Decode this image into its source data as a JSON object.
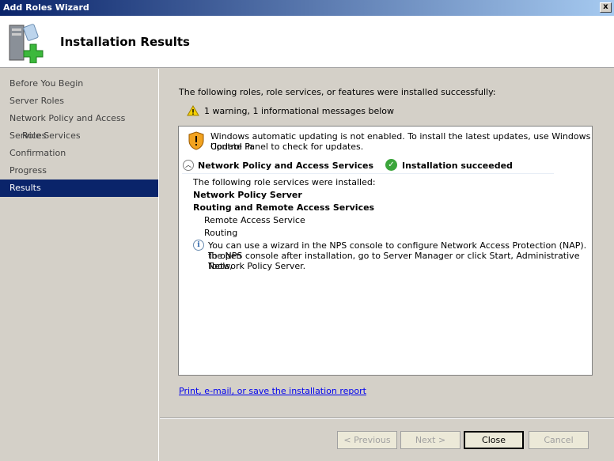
{
  "window": {
    "title": "Add Roles Wizard",
    "close": "x"
  },
  "header": {
    "title": "Installation Results"
  },
  "sidebar": {
    "items": [
      {
        "label": "Before You Begin"
      },
      {
        "label": "Server Roles"
      },
      {
        "label": "Network Policy and Access Services"
      },
      {
        "label": "Role Services"
      },
      {
        "label": "Confirmation"
      },
      {
        "label": "Progress"
      },
      {
        "label": "Results"
      }
    ]
  },
  "main": {
    "intro": "The following roles, role services, or features were installed successfully:",
    "warning_summary": "1 warning, 1 informational messages below",
    "update_warning_1": "Windows automatic updating is not enabled. To install the latest updates, use Windows Update in",
    "update_warning_2": "Control Panel to check for updates.",
    "role_name": "Network Policy and Access Services",
    "role_status": "Installation succeeded",
    "installed_intro": "The following role services were installed:",
    "services": [
      "Network Policy Server",
      "Routing and Remote Access Services",
      "Remote Access Service",
      "Routing"
    ],
    "info_1": "You can use a wizard in the NPS console to configure Network Access Protection (NAP). To open",
    "info_2": "the NPS console after installation, go to Server Manager or click Start, Administrative Tools,",
    "info_3": "Network Policy Server.",
    "report_link": "Print, e-mail, or save the installation report"
  },
  "buttons": {
    "previous": "< Previous",
    "next": "Next >",
    "close": "Close",
    "cancel": "Cancel"
  }
}
